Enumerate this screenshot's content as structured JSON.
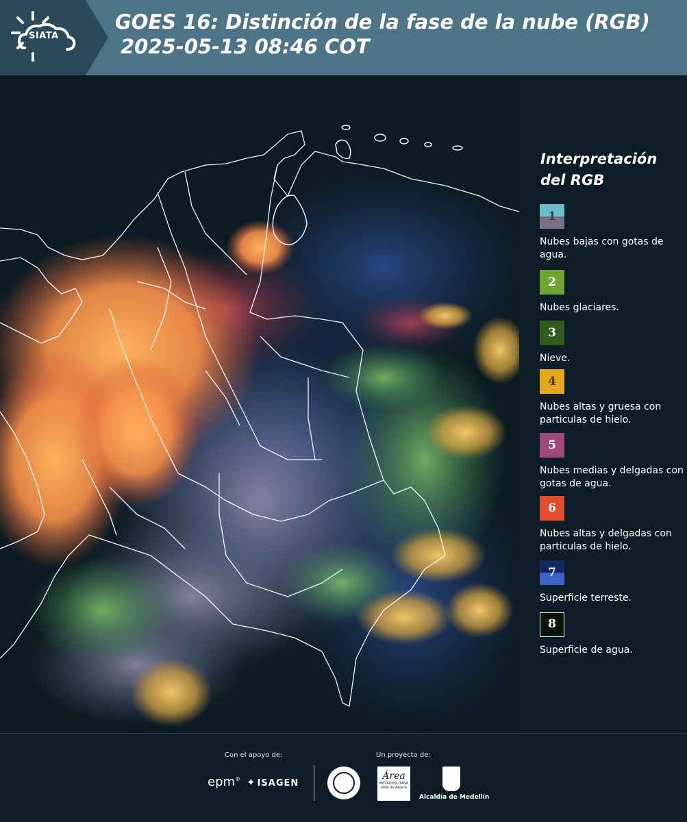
{
  "header": {
    "logo_text": "SIATA",
    "title_line1": "GOES 16: Distinción de la fase de la nube (RGB)",
    "title_line2": "2025-05-13 08:46 COT"
  },
  "legend": {
    "title": "Interpretación del RGB",
    "items": [
      {
        "number": "1",
        "label": "Nubes bajas con gotas de agua.",
        "color_top": "#6bbdc8",
        "color_bottom": "#7a6e8b",
        "text_color": "#3a3340"
      },
      {
        "number": "2",
        "label": "Nubes glaciares.",
        "color": "#6ea42f",
        "text_color": "#ffffff"
      },
      {
        "number": "3",
        "label": "Nieve.",
        "color": "#2f5b1d",
        "text_color": "#ffffff"
      },
      {
        "number": "4",
        "label": "Nubes altas y gruesa con particulas de hielo.",
        "color": "#e3a91e",
        "text_color": "#4a3b1a"
      },
      {
        "number": "5",
        "label": "Nubes medias y delgadas con gotas de agua.",
        "color": "#9e4a7c",
        "text_color": "#ffffff"
      },
      {
        "number": "6",
        "label": "Nubes altas y delgadas con particulas de hielo.",
        "color": "#e24d2c",
        "text_color": "#ffffff"
      },
      {
        "number": "7",
        "label": "Superficie terreste.",
        "color_top": "#14285f",
        "color_bottom": "#3b64c4",
        "text_color": "#ffffff"
      },
      {
        "number": "8",
        "label": "Superficie de agua.",
        "color": "#07150d",
        "text_color": "#ffffff",
        "border": "#ffffff"
      }
    ]
  },
  "footer": {
    "support_label": "Con el apoyo de:",
    "project_label": "Un proyecto de:",
    "epm": "epm",
    "isagen": "ISAGEN",
    "area_main": "Área",
    "area_sub": "METROPOLITANA Valle de Aburrá",
    "alcaldia": "Alcaldía de Medellín"
  }
}
